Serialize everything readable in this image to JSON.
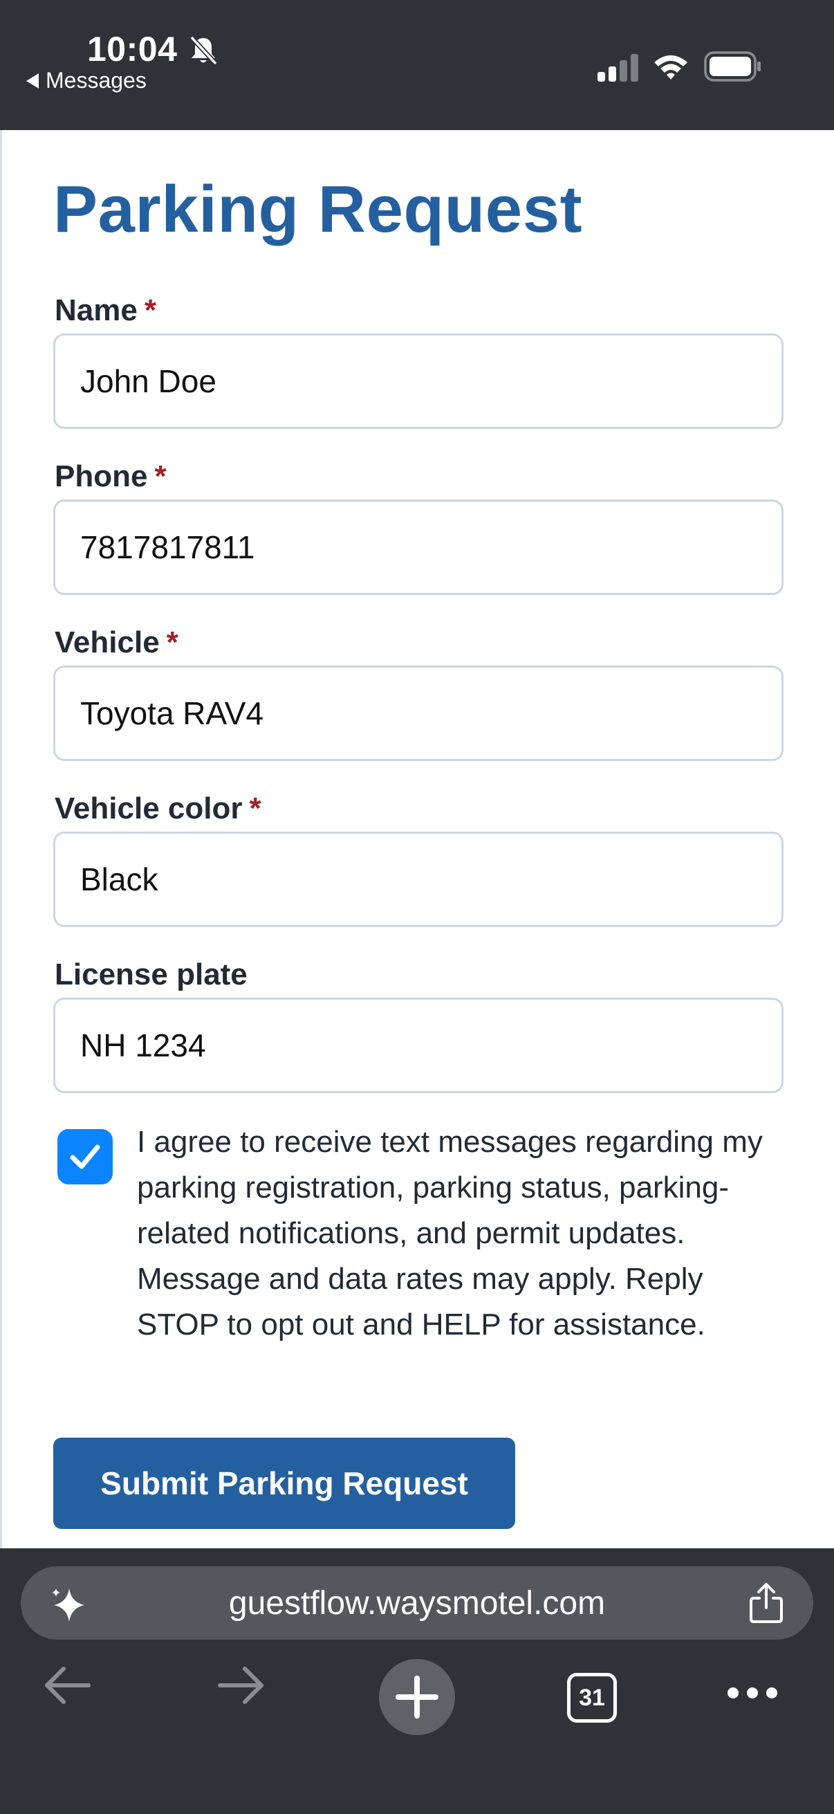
{
  "status_bar": {
    "time": "10:04",
    "back_app": "Messages"
  },
  "form": {
    "title": "Parking Request",
    "required_mark": "*",
    "fields": [
      {
        "label": "Name",
        "required": true,
        "value": "John Doe"
      },
      {
        "label": "Phone",
        "required": true,
        "value": "7817817811"
      },
      {
        "label": "Vehicle",
        "required": true,
        "value": "Toyota RAV4"
      },
      {
        "label": "Vehicle color",
        "required": true,
        "value": "Black"
      },
      {
        "label": "License plate",
        "required": false,
        "value": "NH 1234"
      }
    ],
    "consent_checked": true,
    "consent_text": "I agree to receive text messages regarding my parking registration, parking status, parking-related notifications, and permit updates. Message and data rates may apply. Reply STOP to opt out and HELP for assistance.",
    "submit_label": "Submit Parking Request"
  },
  "browser": {
    "url": "guestflow.waysmotel.com",
    "tab_count": "31"
  },
  "colors": {
    "title": "#2460a0",
    "required": "#a31f25",
    "checkbox": "#0a84ff",
    "button": "#2460a0",
    "chrome": "#2f3236"
  }
}
